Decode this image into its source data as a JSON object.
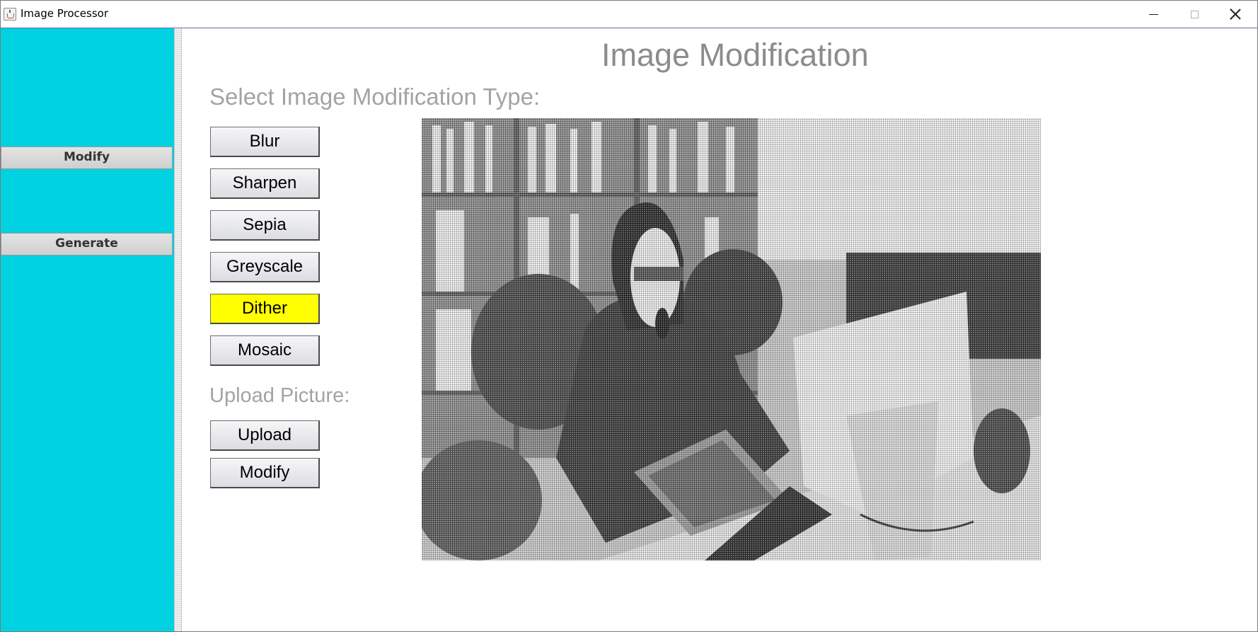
{
  "window": {
    "title": "Image Processor",
    "controls": [
      "minimize",
      "maximize",
      "close"
    ]
  },
  "sidebar": {
    "background_color": "#00d2e1",
    "items": [
      {
        "label": "Modify"
      },
      {
        "label": "Generate"
      }
    ]
  },
  "main": {
    "title": "Image Modification",
    "select_label": "Select Image Modification Type:",
    "modification_buttons": [
      {
        "label": "Blur",
        "selected": false
      },
      {
        "label": "Sharpen",
        "selected": false
      },
      {
        "label": "Sepia",
        "selected": false
      },
      {
        "label": "Greyscale",
        "selected": false
      },
      {
        "label": "Dither",
        "selected": true,
        "highlight_color": "#ffff00"
      },
      {
        "label": "Mosaic",
        "selected": false
      }
    ],
    "upload_label": "Upload Picture:",
    "upload_buttons": [
      {
        "label": "Upload"
      },
      {
        "label": "Modify"
      }
    ],
    "preview": {
      "effect": "dither",
      "description_icon": "image-preview"
    }
  }
}
